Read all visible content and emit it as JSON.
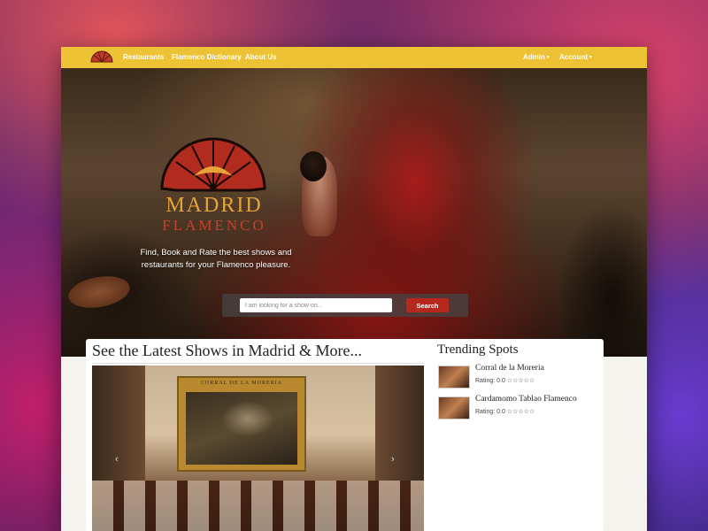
{
  "nav": {
    "items": [
      "Restaurants",
      "Flamenco Dictionary",
      "About Us"
    ],
    "admin": "Admin",
    "account": "Account"
  },
  "hero": {
    "brand_line1": "MADRID",
    "brand_line2": "FLAMENCO",
    "tagline": "Find, Book and Rate the best shows and restaurants for your Flamenco pleasure.",
    "search_placeholder": "I am looking for a show on...",
    "search_button": "Search"
  },
  "shows": {
    "title": "See the Latest Shows in Madrid & More...",
    "image_label": "CORRAL DE LA MORERIA"
  },
  "trending": {
    "title": "Trending Spots",
    "items": [
      {
        "name": "Corral de la Moreria",
        "rating": "Rating: 0.0 ☆☆☆☆☆"
      },
      {
        "name": "Cardamomo Tablao Flamenco",
        "rating": "Rating: 0.0 ☆☆☆☆☆"
      }
    ]
  },
  "colors": {
    "nav_bg": "#edc234",
    "search_button": "#b6281c",
    "brand_gold": "#e8a23a",
    "brand_red": "#c8402a"
  },
  "icons": {
    "logo": "fan-logo-icon",
    "caret": "caret-down-icon",
    "prev": "chevron-left-icon",
    "next": "chevron-right-icon"
  }
}
